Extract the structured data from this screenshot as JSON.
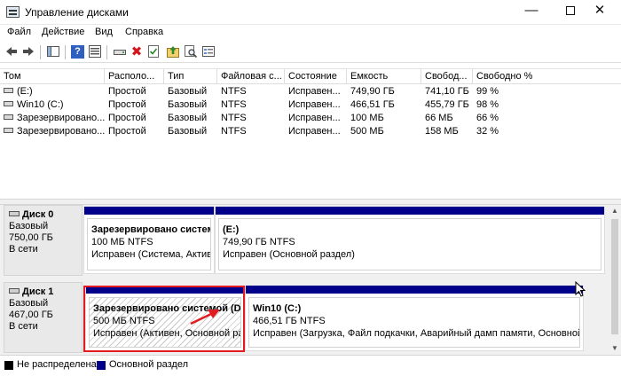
{
  "window": {
    "title": "Управление дисками",
    "minimize": "—",
    "close": "✕"
  },
  "menu": [
    "Файл",
    "Действие",
    "Вид",
    "Справка"
  ],
  "toolbar": {
    "back_icon": "back-arrow-icon",
    "forward_icon": "forward-arrow-icon",
    "delete_glyph": "✖",
    "help_glyph": "?"
  },
  "volume_table": {
    "columns": [
      "Том",
      "Располо...",
      "Тип",
      "Файловая с...",
      "Состояние",
      "Емкость",
      "Свобод...",
      "Свободно %"
    ],
    "rows": [
      [
        "(E:)",
        "Простой",
        "Базовый",
        "NTFS",
        "Исправен...",
        "749,90 ГБ",
        "741,10 ГБ",
        "99 %"
      ],
      [
        "Win10 (C:)",
        "Простой",
        "Базовый",
        "NTFS",
        "Исправен...",
        "466,51 ГБ",
        "455,79 ГБ",
        "98 %"
      ],
      [
        "Зарезервировано...",
        "Простой",
        "Базовый",
        "NTFS",
        "Исправен...",
        "100 МБ",
        "66 МБ",
        "66 %"
      ],
      [
        "Зарезервировано...",
        "Простой",
        "Базовый",
        "NTFS",
        "Исправен...",
        "500 МБ",
        "158 МБ",
        "32 %"
      ]
    ]
  },
  "disks": [
    {
      "name": "Диск 0",
      "type": "Базовый",
      "size": "750,00 ГБ",
      "status": "В сети",
      "partitions": [
        {
          "name": "Зарезервировано системой",
          "size": "100 МБ NTFS",
          "status": "Исправен (Система, Активе"
        },
        {
          "name": "(E:)",
          "size": "749,90 ГБ NTFS",
          "status": "Исправен (Основной раздел)"
        }
      ]
    },
    {
      "name": "Диск 1",
      "type": "Базовый",
      "size": "467,00 ГБ",
      "status": "В сети",
      "partitions": [
        {
          "name": "Зарезервировано системой  (D:)",
          "size": "500 МБ NTFS",
          "status": "Исправен (Активен, Основной разд"
        },
        {
          "name": "Win10  (C:)",
          "size": "466,51 ГБ NTFS",
          "status": "Исправен (Загрузка, Файл подкачки, Аварийный дамп памяти, Основной р"
        }
      ]
    }
  ],
  "legend": {
    "unallocated": "Не распределена",
    "primary": "Основной раздел",
    "unallocated_color": "#000000",
    "primary_color": "#00008b"
  },
  "highlight_color": "#e21b22"
}
